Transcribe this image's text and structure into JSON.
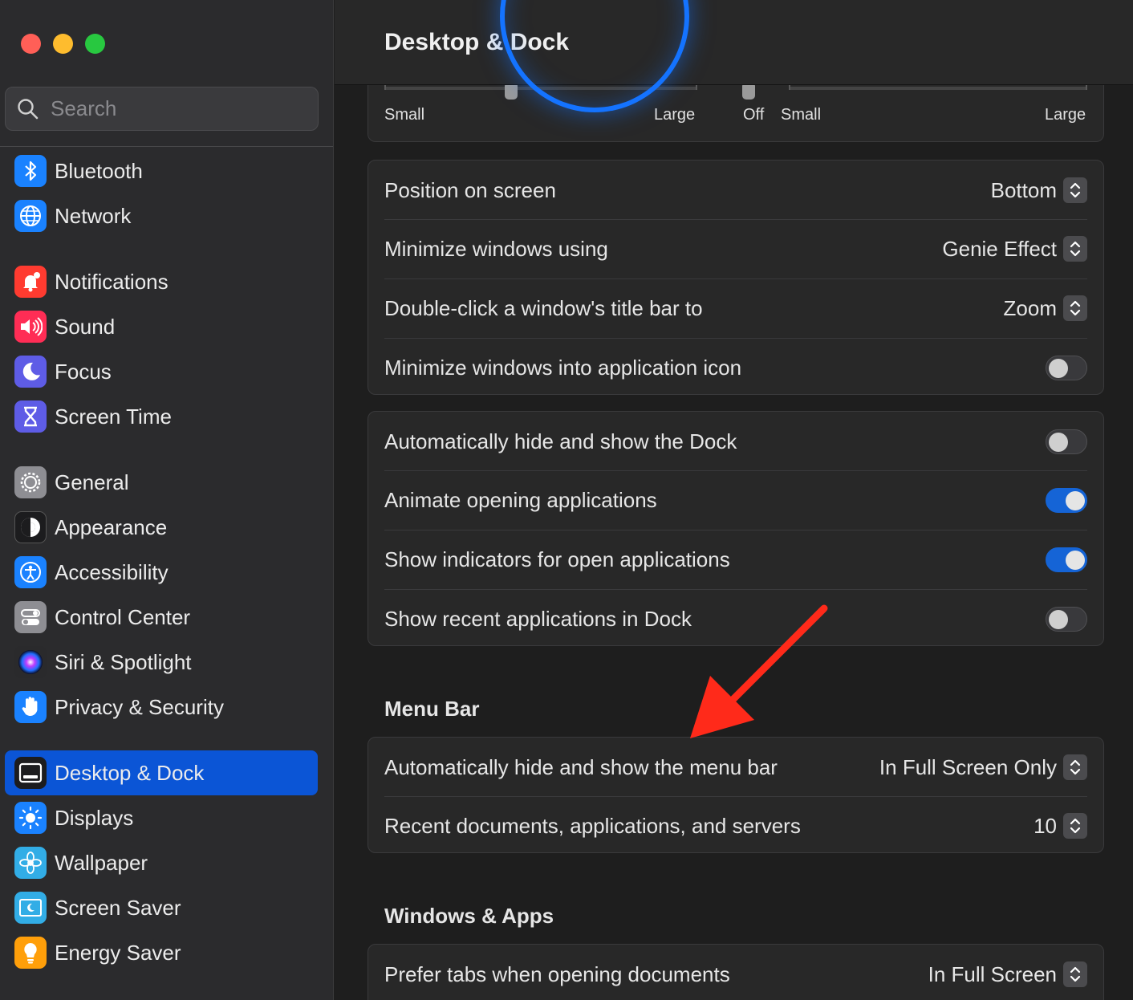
{
  "window": {
    "title": "Desktop & Dock",
    "traffic_lights": [
      "#ff5f57",
      "#febc2e",
      "#28c840"
    ]
  },
  "search": {
    "placeholder": "Search",
    "icon": "magnifier-icon"
  },
  "sidebar": {
    "items": [
      {
        "label": "Bluetooth",
        "icon": "bluetooth-icon",
        "color": "#1a82ff"
      },
      {
        "label": "Network",
        "icon": "globe-icon",
        "color": "#1a82ff"
      },
      {
        "label": "Notifications",
        "icon": "bell-icon",
        "color": "#ff3b30"
      },
      {
        "label": "Sound",
        "icon": "speaker-icon",
        "color": "#ff2d55"
      },
      {
        "label": "Focus",
        "icon": "moon-icon",
        "color": "#5e5ce6"
      },
      {
        "label": "Screen Time",
        "icon": "hourglass-icon",
        "color": "#5e5ce6"
      },
      {
        "label": "General",
        "icon": "gear-icon",
        "color": "#8e8e93"
      },
      {
        "label": "Appearance",
        "icon": "appearance-icon",
        "color": "#1c1c1e"
      },
      {
        "label": "Accessibility",
        "icon": "accessibility-icon",
        "color": "#1a82ff"
      },
      {
        "label": "Control Center",
        "icon": "toggles-icon",
        "color": "#8e8e93"
      },
      {
        "label": "Siri & Spotlight",
        "icon": "siri-icon",
        "color": "#3a3a3c"
      },
      {
        "label": "Privacy & Security",
        "icon": "hand-icon",
        "color": "#1a82ff"
      },
      {
        "label": "Desktop & Dock",
        "icon": "dock-icon",
        "color": "#1c1c1e",
        "selected": true
      },
      {
        "label": "Displays",
        "icon": "sun-icon",
        "color": "#1a82ff"
      },
      {
        "label": "Wallpaper",
        "icon": "flower-icon",
        "color": "#32ade6"
      },
      {
        "label": "Screen Saver",
        "icon": "screensaver-icon",
        "color": "#32ade6"
      },
      {
        "label": "Energy Saver",
        "icon": "bulb-icon",
        "color": "#ff9f0a"
      }
    ]
  },
  "sliders": {
    "size": {
      "min_label": "Small",
      "max_label": "Large"
    },
    "magnification": {
      "off_label": "Off",
      "min_label": "Small",
      "max_label": "Large"
    }
  },
  "dock_group": [
    {
      "label": "Position on screen",
      "value": "Bottom"
    },
    {
      "label": "Minimize windows using",
      "value": "Genie Effect"
    },
    {
      "label": "Double-click a window's title bar to",
      "value": "Zoom"
    },
    {
      "label": "Minimize windows into application icon",
      "toggle": false
    }
  ],
  "behavior_group": [
    {
      "label": "Automatically hide and show the Dock",
      "toggle": false
    },
    {
      "label": "Animate opening applications",
      "toggle": true
    },
    {
      "label": "Show indicators for open applications",
      "toggle": true
    },
    {
      "label": "Show recent applications in Dock",
      "toggle": false
    }
  ],
  "menu_bar": {
    "title": "Menu Bar",
    "rows": [
      {
        "label": "Automatically hide and show the menu bar",
        "value": "In Full Screen Only"
      },
      {
        "label": "Recent documents, applications, and servers",
        "value": "10"
      }
    ]
  },
  "windows_apps": {
    "title": "Windows & Apps",
    "rows": [
      {
        "label": "Prefer tabs when opening documents",
        "value": "In Full Screen"
      }
    ]
  },
  "colors": {
    "accent": "#0b55d6",
    "annotation_arrow": "#ff2a1a",
    "focus_ring": "#1473ff"
  }
}
